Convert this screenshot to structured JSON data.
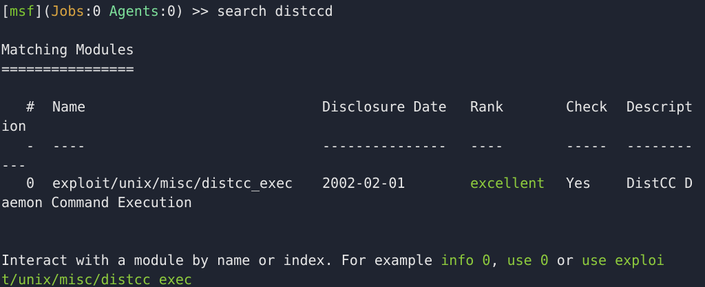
{
  "prompt": {
    "open_bracket": "[",
    "name": "msf",
    "close_bracket": "]",
    "open_paren": "(",
    "jobs_label": "Jobs",
    "jobs_sep": ":",
    "jobs_value": "0",
    "agents_label": "Agents",
    "agents_sep": ":",
    "agents_value": "0",
    "close_paren": ")",
    "arrow": " >> ",
    "command": "search distccd"
  },
  "section": {
    "title": "Matching Modules",
    "underline": "================"
  },
  "table": {
    "headers": {
      "num": "#",
      "name": "Name",
      "date": "Disclosure Date",
      "rank": "Rank",
      "check": "Check",
      "desc_part1": "Descript",
      "desc_part2": "ion"
    },
    "dashes": {
      "num": "-",
      "name": "----",
      "date": "---------------",
      "rank": "----",
      "check": "-----",
      "desc_part1": "--------",
      "desc_part2": "---"
    },
    "rows": [
      {
        "num": "0",
        "name": "exploit/unix/misc/distcc_exec",
        "date": "2002-02-01",
        "rank": "excellent",
        "check": "Yes",
        "desc_part1": "DistCC D",
        "desc_part2": "aemon Command Execution"
      }
    ]
  },
  "hint": {
    "prefix": "Interact with a module by name or index. For example ",
    "cmd1": "info 0",
    "sep1": ", ",
    "cmd2": "use 0",
    "sep2": " or ",
    "cmd3_part1": "use exploi",
    "cmd3_part2": "t/unix/misc/distcc_exec"
  },
  "colors": {
    "background": "#1f2430",
    "text": "#e6e6e6",
    "msf": "#7fc832",
    "jobs": "#d9a441",
    "agents": "#7ddf9a",
    "rank_excellent": "#8ecb3d",
    "hint_command": "#8ecb3d"
  }
}
